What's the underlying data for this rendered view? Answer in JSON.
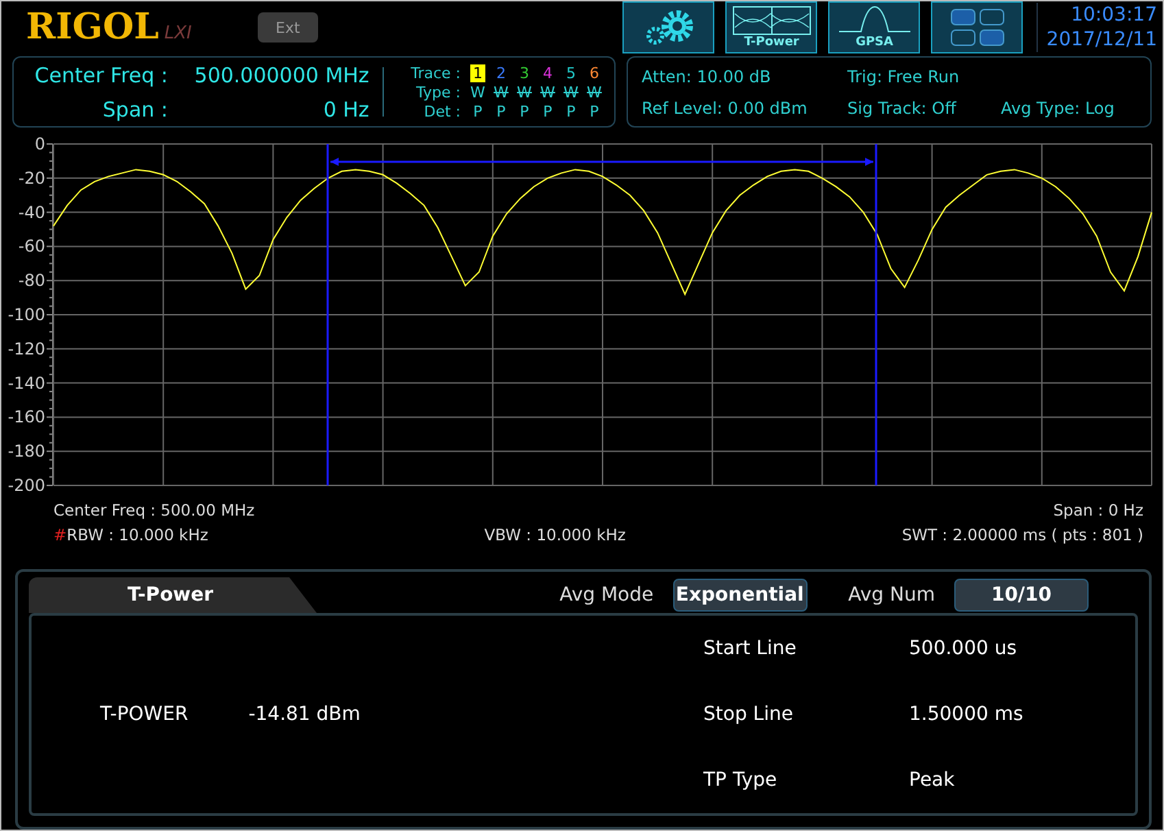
{
  "header": {
    "logo": "RIGOL",
    "logo_badge": "LXI",
    "ext_button": {
      "label": "Ext",
      "disabled": true
    },
    "center_freq": {
      "label": "Center Freq :",
      "value": "500.000000 MHz"
    },
    "span": {
      "label": "Span :",
      "value": "0 Hz"
    },
    "trace_label": "Trace :",
    "type_label": "Type :",
    "det_label": "Det :",
    "traces": [
      {
        "number": "1",
        "color": "#ffff00",
        "selected": true,
        "type": "W",
        "struck": false,
        "det": "P"
      },
      {
        "number": "2",
        "color": "#3a7bff",
        "selected": false,
        "type": "W",
        "struck": true,
        "det": "P"
      },
      {
        "number": "3",
        "color": "#33cc33",
        "selected": false,
        "type": "W",
        "struck": true,
        "det": "P"
      },
      {
        "number": "4",
        "color": "#dd33dd",
        "selected": false,
        "type": "W",
        "struck": true,
        "det": "P"
      },
      {
        "number": "5",
        "color": "#22cccc",
        "selected": false,
        "type": "W",
        "struck": true,
        "det": "P"
      },
      {
        "number": "6",
        "color": "#ff8833",
        "selected": false,
        "type": "W",
        "struck": true,
        "det": "P"
      }
    ],
    "tool_buttons": [
      {
        "kind": "settings"
      },
      {
        "kind": "t-power",
        "label": "T-Power"
      },
      {
        "kind": "gpsa",
        "label": "GPSA"
      },
      {
        "kind": "layout"
      }
    ],
    "clock": {
      "time": "10:03:17",
      "date": "2017/12/11"
    },
    "status_rows": [
      [
        "Atten: 10.00 dB",
        "Trig: Free Run"
      ],
      [
        "Ref Level: 0.00 dBm",
        "Sig Track: Off",
        "Avg Type: Log"
      ]
    ]
  },
  "plot": {
    "chart_data": {
      "type": "line",
      "grid": true,
      "ylim": [
        -200,
        0
      ],
      "yticks": [
        0,
        -20,
        -40,
        -60,
        -80,
        -100,
        -120,
        -140,
        -160,
        -180,
        -200
      ],
      "categories": [
        null,
        null,
        null,
        null,
        null,
        null,
        null,
        null,
        null,
        null,
        null,
        null,
        null,
        null,
        null,
        null,
        null,
        null,
        null,
        null,
        null,
        null,
        null,
        null,
        null,
        null,
        null,
        null,
        null,
        null,
        null,
        null,
        null,
        null,
        null,
        null,
        null,
        null,
        null,
        null,
        null,
        null,
        null,
        null,
        null,
        null,
        null,
        null,
        null,
        null,
        null,
        null,
        null,
        null,
        null,
        null,
        null,
        null,
        null,
        null,
        null,
        null,
        null,
        null,
        null,
        null,
        null,
        null,
        null,
        null,
        null,
        null,
        null,
        null,
        null,
        null,
        null,
        null,
        null,
        null,
        null
      ],
      "series": [
        {
          "color": "#ffff33",
          "values": [
            -48,
            -36,
            -27,
            -22,
            -19,
            -17,
            -15,
            -16,
            -18,
            -22,
            -28,
            -35,
            -48,
            -64,
            -85,
            -77,
            -56,
            -43,
            -33,
            -26,
            -20,
            -16,
            -15,
            -16,
            -18,
            -23,
            -29,
            -36,
            -49,
            -66,
            -83,
            -75,
            -54,
            -41,
            -32,
            -25,
            -20,
            -17,
            -15,
            -16,
            -19,
            -24,
            -30,
            -39,
            -52,
            -70,
            -88,
            -70,
            -52,
            -39,
            -30,
            -24,
            -19,
            -16,
            -15,
            -16,
            -20,
            -25,
            -31,
            -40,
            -53,
            -73,
            -84,
            -68,
            -50,
            -37,
            -30,
            -24,
            -18,
            -16,
            -15,
            -17,
            -20,
            -25,
            -32,
            -41,
            -54,
            -75,
            -86,
            -66,
            -40
          ]
        }
      ]
    }
  },
  "plot_info": {
    "center_freq": "Center Freq : 500.00 MHz",
    "span": "Span : 0 Hz",
    "rbw_mark": "#",
    "rbw": "RBW : 10.000 kHz",
    "vbw": "VBW : 10.000 kHz",
    "swt": "SWT : 2.00000 ms ( pts : 801 )"
  },
  "panel": {
    "tab": "T-Power",
    "avg_mode_label": "Avg Mode",
    "avg_mode": "Exponential",
    "avg_num_label": "Avg Num",
    "avg_num": "10/10",
    "result_label": "T-POWER",
    "result_value": "-14.81 dBm",
    "params": [
      {
        "label": "Start Line",
        "value": "500.000 us"
      },
      {
        "label": "Stop Line",
        "value": "1.50000 ms"
      },
      {
        "label": "TP Type",
        "value": "Peak"
      }
    ]
  }
}
